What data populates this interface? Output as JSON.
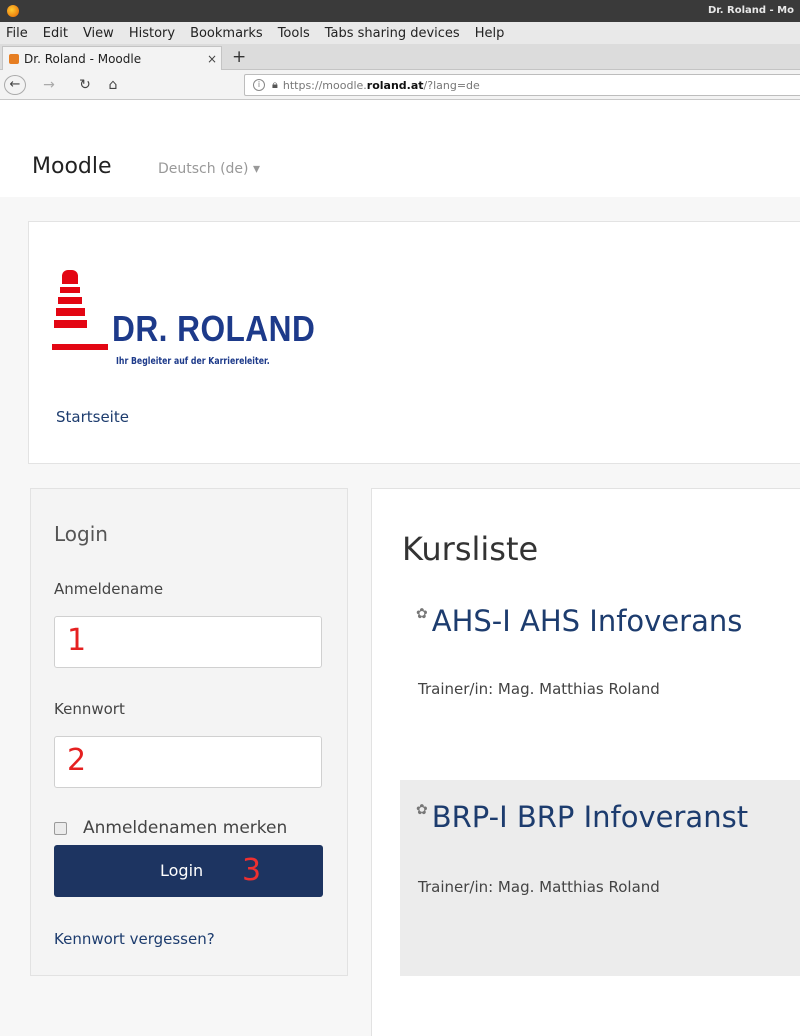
{
  "browser": {
    "window_title": "Dr. Roland - Mo",
    "menu": [
      "File",
      "Edit",
      "View",
      "History",
      "Bookmarks",
      "Tools",
      "Tabs sharing devices",
      "Help"
    ],
    "tab_title": "Dr. Roland - Moodle",
    "tab_close": "×",
    "new_tab": "+",
    "url_prefix": "https://moodle.",
    "url_domain": "roland.at",
    "url_suffix": "/?lang=de"
  },
  "moodle": {
    "brand": "Moodle",
    "language": "Deutsch (de) ▾"
  },
  "header": {
    "logo_name": "DR. ROLAND",
    "logo_tagline": "Ihr Begleiter auf der Karriereleiter.",
    "breadcrumb": "Startseite"
  },
  "login": {
    "title": "Login",
    "username_label": "Anmeldename",
    "username_marker": "1",
    "password_label": "Kennwort",
    "password_marker": "2",
    "remember_label": "Anmeldenamen merken",
    "button_label": "Login",
    "button_marker": "3",
    "forgot_link": "Kennwort vergessen?"
  },
  "courses": {
    "heading": "Kursliste",
    "items": [
      {
        "title": "AHS-I AHS Infoverans",
        "trainer": "Trainer/in: Mag. Matthias Roland"
      },
      {
        "title": "BRP-I BRP Infoveranst",
        "trainer": "Trainer/in: Mag. Matthias Roland"
      }
    ]
  },
  "colors": {
    "primary": "#1d3461",
    "logo_red": "#e30613",
    "logo_blue": "#1d3a8a",
    "annotation_red": "#e52020"
  }
}
